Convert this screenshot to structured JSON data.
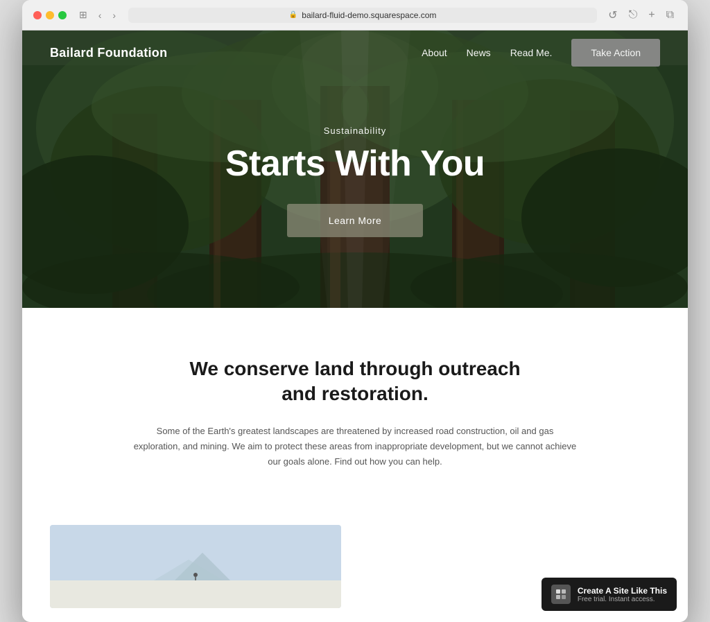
{
  "browser": {
    "url": "bailard-fluid-demo.squarespace.com",
    "reload_label": "↺"
  },
  "nav": {
    "logo": "Bailard Foundation",
    "links": [
      "About",
      "News",
      "Read Me."
    ],
    "cta": "Take Action"
  },
  "hero": {
    "subtitle": "Sustainability",
    "title": "Starts With You",
    "button": "Learn More"
  },
  "main": {
    "heading": "We conserve land through outreach and restoration.",
    "description": "Some of the Earth's greatest landscapes are threatened by increased road construction, oil and gas exploration, and mining. We aim to protect these areas from inappropriate development, but we cannot achieve our goals alone. Find out how you can help."
  },
  "badge": {
    "title": "Create A Site Like This",
    "subtitle": "Free trial. Instant access."
  }
}
